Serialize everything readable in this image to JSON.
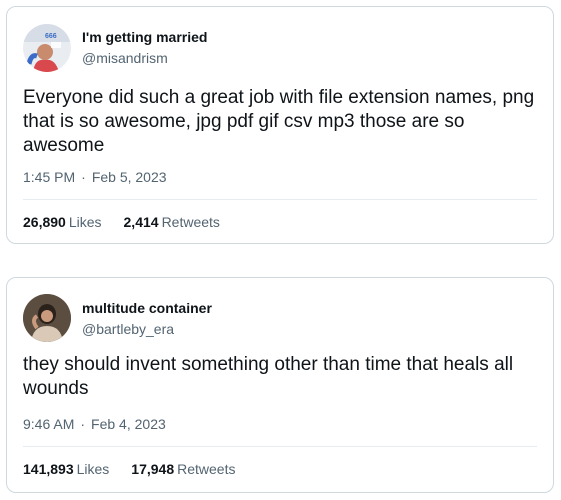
{
  "tweets": [
    {
      "name": "I'm getting married",
      "handle": "@misandrism",
      "text": "Everyone did such a great job with file extension names, png that is so awesome, jpg pdf gif csv mp3 those are so awesome",
      "time": "1:45 PM",
      "date": "Feb 5, 2023",
      "likes": "26,890",
      "likes_label": "Likes",
      "retweets": "2,414",
      "retweets_label": "Retweets"
    },
    {
      "name": "multitude container",
      "handle": "@bartleby_era",
      "text": "they should invent something other than time that heals all wounds",
      "time": "9:46 AM",
      "date": "Feb 4, 2023",
      "likes": "141,893",
      "likes_label": "Likes",
      "retweets": "17,948",
      "retweets_label": "Retweets"
    }
  ],
  "separator": "·",
  "avatar1_text": "666"
}
